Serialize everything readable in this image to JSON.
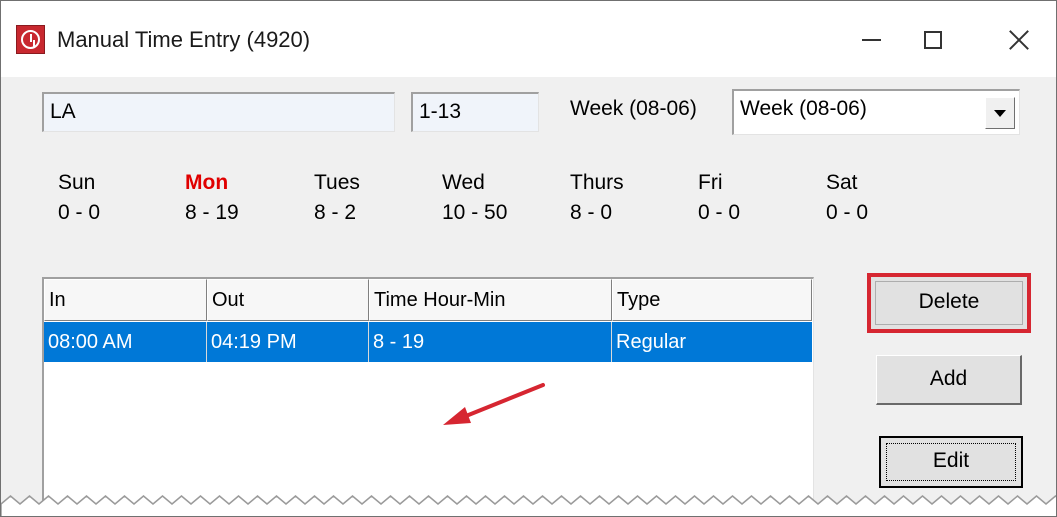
{
  "window": {
    "title": "Manual Time Entry (4920)"
  },
  "fields": {
    "name_value": "LA",
    "code_value": "1-13",
    "week_label": "Week (08-06)",
    "week_select_value": "Week (08-06)"
  },
  "days": [
    {
      "name": "Sun",
      "value": "0 - 0"
    },
    {
      "name": "Mon",
      "value": "8 - 19",
      "active": true
    },
    {
      "name": "Tues",
      "value": "8 - 2"
    },
    {
      "name": "Wed",
      "value": "10 - 50"
    },
    {
      "name": "Thurs",
      "value": "8 - 0"
    },
    {
      "name": "Fri",
      "value": "0 - 0"
    },
    {
      "name": "Sat",
      "value": "0 - 0"
    }
  ],
  "table": {
    "columns": [
      "In",
      "Out",
      "Time Hour-Min",
      "Type"
    ],
    "rows": [
      [
        "08:00 AM",
        "04:19 PM",
        "8 - 19",
        "Regular"
      ]
    ]
  },
  "buttons": {
    "delete": "Delete",
    "add": "Add",
    "edit": "Edit"
  },
  "colors": {
    "active_day": "#e00000",
    "selection": "#0078d7",
    "highlight": "#d62631",
    "annotation_arrow": "#d62631"
  }
}
